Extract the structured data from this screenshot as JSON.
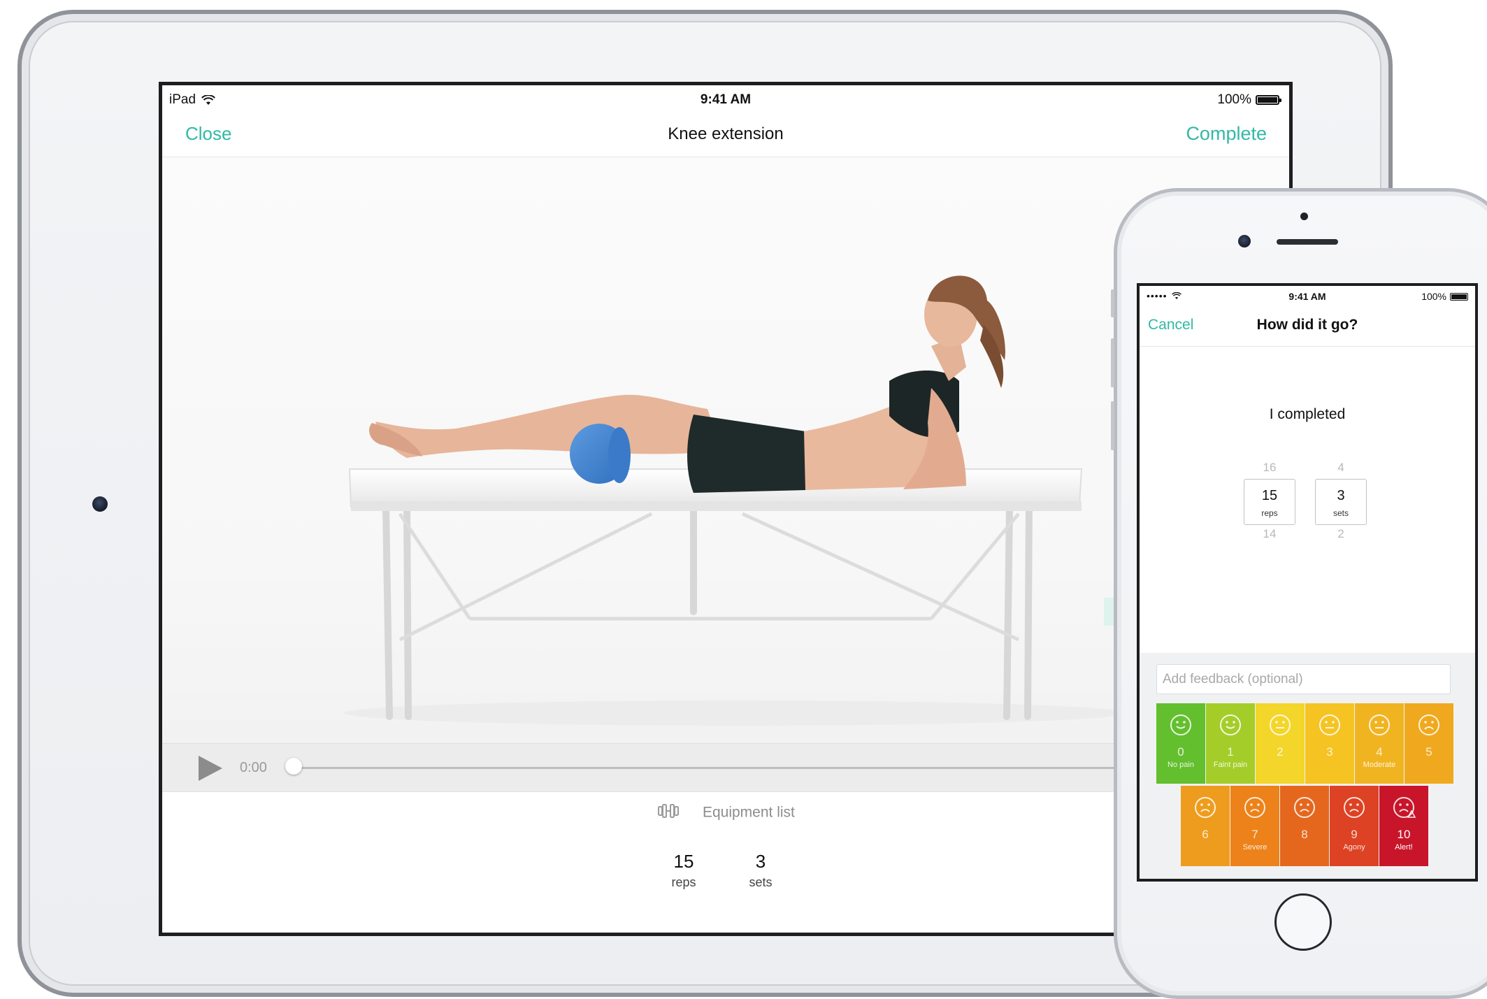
{
  "ipad": {
    "status": {
      "device": "iPad",
      "time": "9:41 AM",
      "battery": "100%"
    },
    "nav": {
      "left": "Close",
      "title": "Knee extension",
      "right": "Complete"
    },
    "player": {
      "time": "0:00",
      "progress": 0.0
    },
    "equipment": {
      "label": "Equipment list"
    },
    "stats": [
      {
        "value": "15",
        "unit": "reps"
      },
      {
        "value": "3",
        "unit": "sets"
      }
    ]
  },
  "iphone": {
    "status": {
      "carrier_dots": "•••••",
      "time": "9:41 AM",
      "battery": "100%"
    },
    "nav": {
      "left": "Cancel",
      "title": "How did it go?"
    },
    "completed_label": "I completed",
    "pickers": [
      {
        "above": "16",
        "value": "15",
        "unit": "reps",
        "below": "14"
      },
      {
        "above": "4",
        "value": "3",
        "unit": "sets",
        "below": "2"
      }
    ],
    "feedback_placeholder": "Add feedback (optional)",
    "pain_scale": [
      {
        "level": "0",
        "label": "No pain",
        "color": "#63bf2e",
        "mood": "happy"
      },
      {
        "level": "1",
        "label": "Faint pain",
        "color": "#a4cd2a",
        "mood": "happy"
      },
      {
        "level": "2",
        "label": "",
        "color": "#f3d629",
        "mood": "neutral"
      },
      {
        "level": "3",
        "label": "",
        "color": "#f5c423",
        "mood": "neutral"
      },
      {
        "level": "4",
        "label": "Moderate",
        "color": "#f1b421",
        "mood": "neutral"
      },
      {
        "level": "5",
        "label": "",
        "color": "#f0a91e",
        "mood": "sad"
      },
      {
        "level": "6",
        "label": "",
        "color": "#ee9c1d",
        "mood": "sad"
      },
      {
        "level": "7",
        "label": "Severe",
        "color": "#ec8219",
        "mood": "sad"
      },
      {
        "level": "8",
        "label": "",
        "color": "#e4671d",
        "mood": "sad"
      },
      {
        "level": "9",
        "label": "Agony",
        "color": "#dc4223",
        "mood": "sad"
      },
      {
        "level": "10",
        "label": "Alert!",
        "color": "#c8152a",
        "mood": "alert"
      }
    ],
    "colors": {
      "accent": "#32b9a4"
    }
  }
}
